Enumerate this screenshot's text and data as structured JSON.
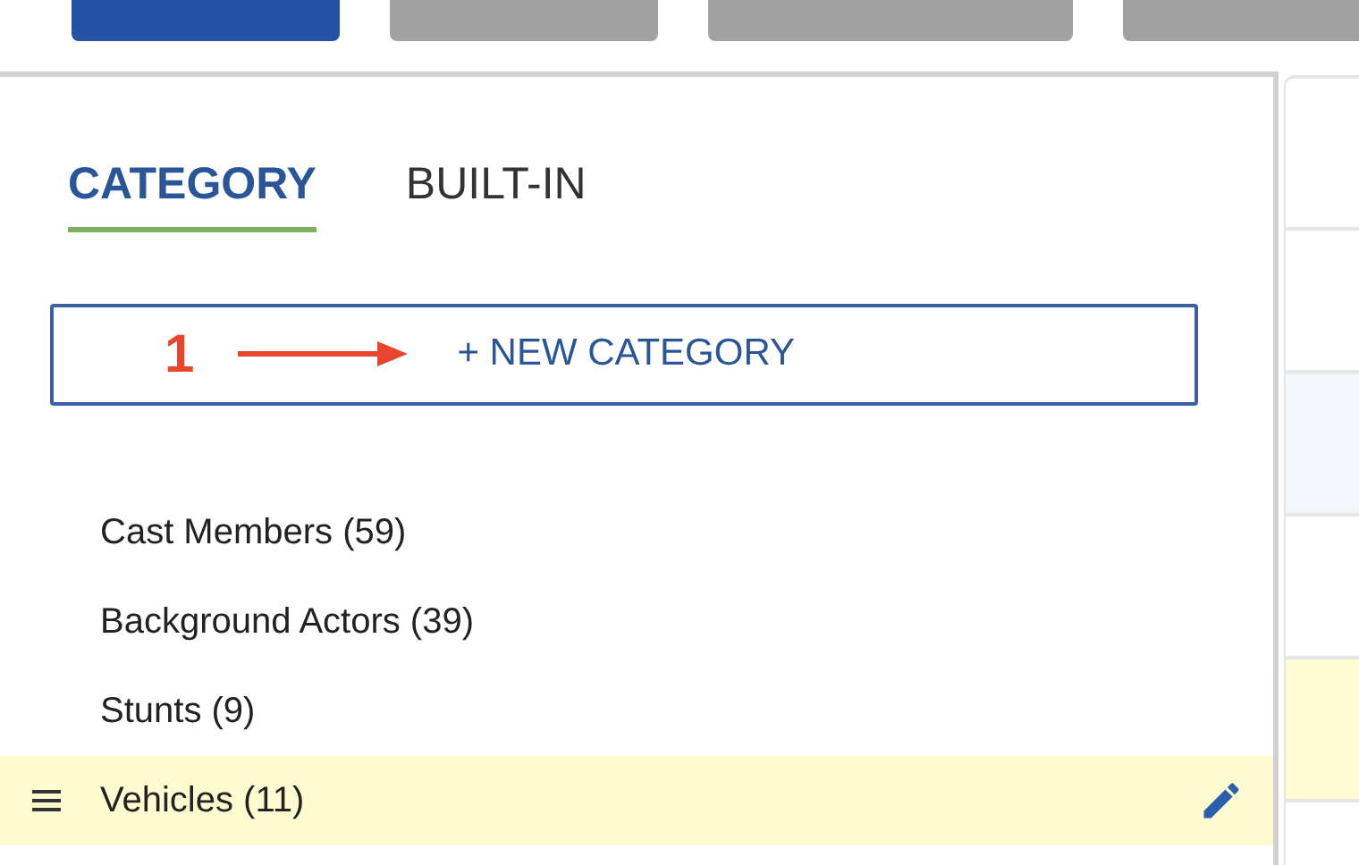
{
  "toolbar": {
    "buttons": [
      {
        "kind": "primary"
      },
      {
        "kind": "secondary"
      },
      {
        "kind": "secondary"
      },
      {
        "kind": "secondary"
      }
    ]
  },
  "tabs": [
    {
      "label": "CATEGORY",
      "selected": true
    },
    {
      "label": "BUILT-IN",
      "selected": false
    }
  ],
  "new_category_button": {
    "label": "+ NEW CATEGORY"
  },
  "annotation": {
    "label": "1"
  },
  "categories": [
    {
      "label": "Cast Members (59)",
      "selected": false
    },
    {
      "label": "Background Actors (39)",
      "selected": false
    },
    {
      "label": "Stunts (9)",
      "selected": false
    },
    {
      "label": "Vehicles (11)",
      "selected": true
    }
  ],
  "right_panel": {
    "rows": [
      {
        "kind": "plain"
      },
      {
        "kind": "plain"
      },
      {
        "kind": "tinted"
      },
      {
        "kind": "plain"
      },
      {
        "kind": "highlight"
      }
    ]
  }
}
